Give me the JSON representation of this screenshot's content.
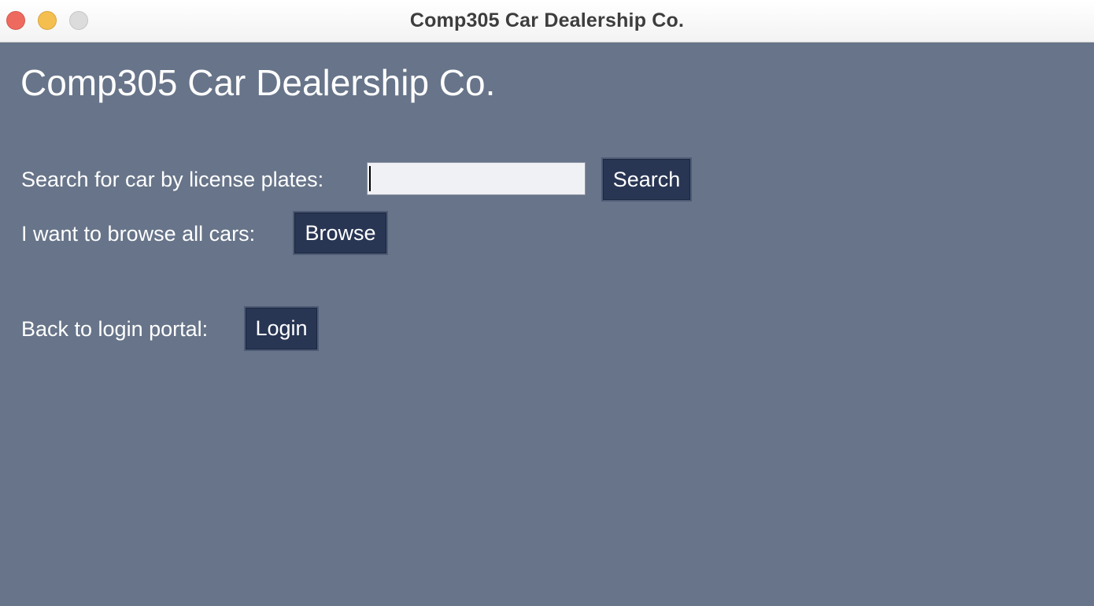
{
  "window": {
    "title": "Comp305 Car Dealership Co."
  },
  "main": {
    "heading": "Comp305 Car Dealership Co.",
    "search": {
      "label": "Search for car by license plates:",
      "input_value": "",
      "button_label": "Search"
    },
    "browse": {
      "label": "I want to browse all cars:",
      "button_label": "Browse"
    },
    "login": {
      "label": "Back to login portal:",
      "button_label": "Login"
    }
  },
  "colors": {
    "background": "#677489",
    "button": "#283553",
    "input": "#f0f1f5"
  }
}
